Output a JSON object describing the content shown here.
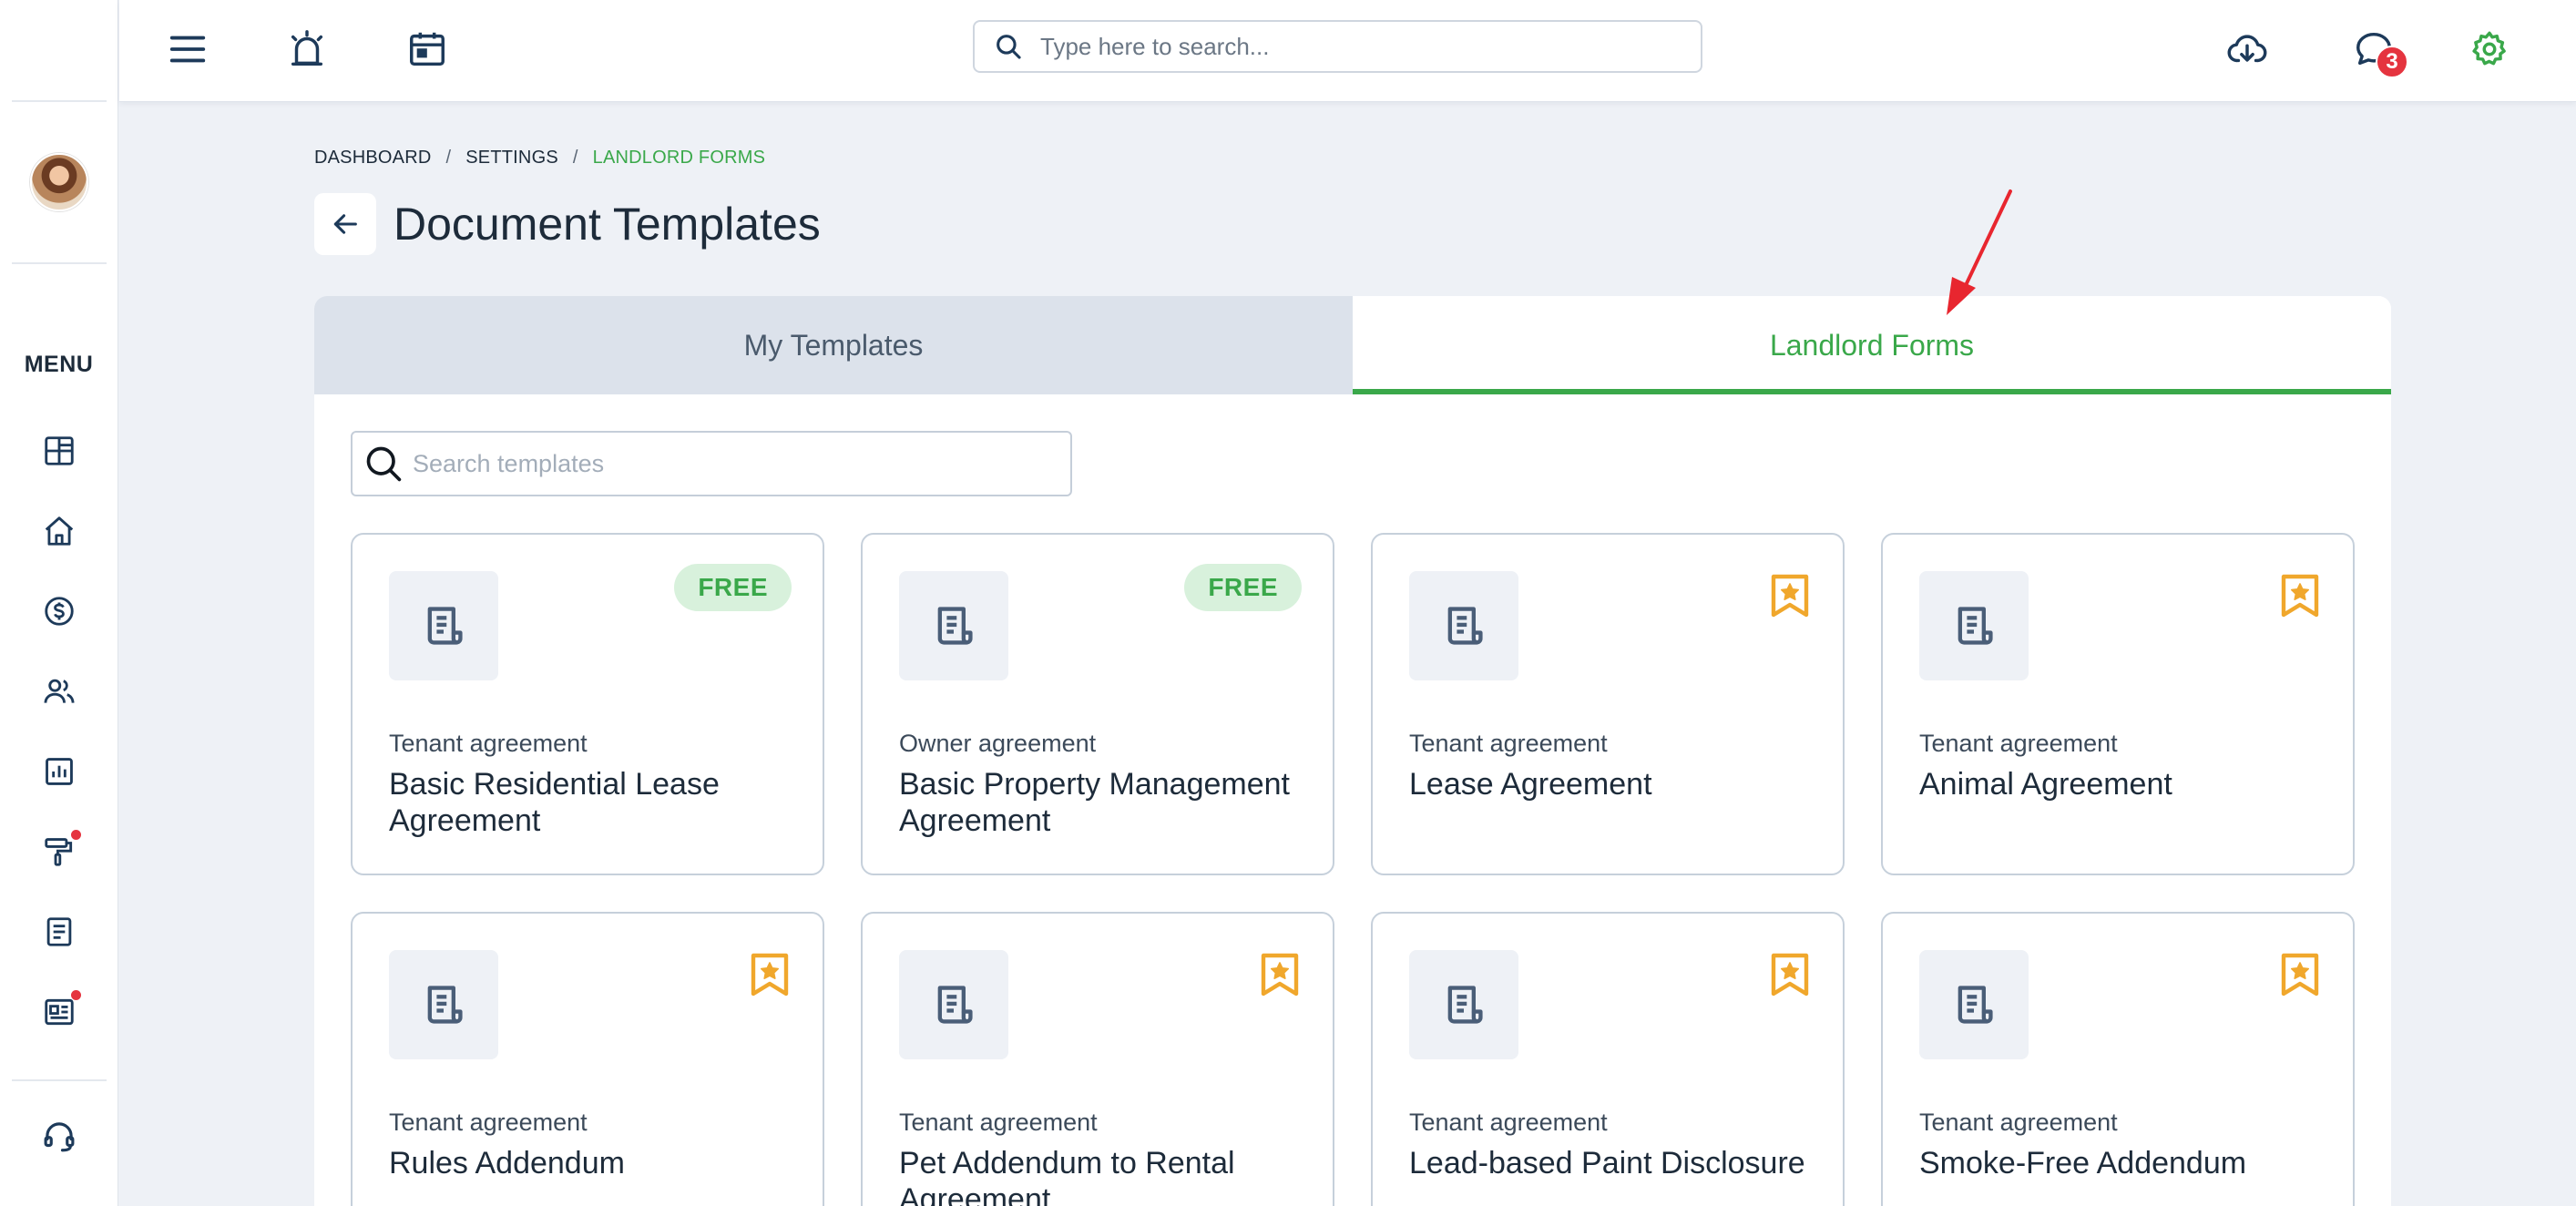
{
  "sidebar": {
    "menu_label": "MENU",
    "items": [
      {
        "name": "dashboard-icon",
        "dot": false
      },
      {
        "name": "home-icon",
        "dot": false
      },
      {
        "name": "dollar-icon",
        "dot": false
      },
      {
        "name": "users-icon",
        "dot": false
      },
      {
        "name": "reports-icon",
        "dot": false
      },
      {
        "name": "paint-roller-icon",
        "dot": true
      },
      {
        "name": "document-icon",
        "dot": false
      },
      {
        "name": "newspaper-icon",
        "dot": true
      }
    ],
    "support_icon": "headset-icon",
    "notification_dot_color": "#e5343f"
  },
  "topbar": {
    "search_placeholder": "Type here to search...",
    "chat_badge_count": "3",
    "icons": [
      "menu-icon",
      "alarm-icon",
      "calendar-icon",
      "download-cloud-icon",
      "chat-icon",
      "gear-icon"
    ]
  },
  "breadcrumb": {
    "items": [
      "DASHBOARD",
      "SETTINGS",
      "LANDLORD FORMS"
    ],
    "separator": "/"
  },
  "page": {
    "title": "Document Templates"
  },
  "tabs": [
    {
      "label": "My Templates",
      "active": false
    },
    {
      "label": "Landlord Forms",
      "active": true
    }
  ],
  "template_search": {
    "placeholder": "Search templates"
  },
  "templates": [
    {
      "category": "Tenant agreement",
      "title": "Basic Residential Lease Agreement",
      "badge": "FREE"
    },
    {
      "category": "Owner agreement",
      "title": "Basic Property Management Agreement",
      "badge": "FREE"
    },
    {
      "category": "Tenant agreement",
      "title": "Lease Agreement",
      "badge": ""
    },
    {
      "category": "Tenant agreement",
      "title": "Animal Agreement",
      "badge": ""
    },
    {
      "category": "Tenant agreement",
      "title": "Rules Addendum",
      "badge": ""
    },
    {
      "category": "Tenant agreement",
      "title": "Pet Addendum to Rental Agreement",
      "badge": ""
    },
    {
      "category": "Tenant agreement",
      "title": "Lead-based Paint Disclosure",
      "badge": ""
    },
    {
      "category": "Tenant agreement",
      "title": "Smoke-Free Addendum",
      "badge": ""
    }
  ],
  "colors": {
    "accent_green": "#3aa84a",
    "bookmark_orange": "#f0a72c",
    "badge_red": "#e5343f",
    "icon_slate": "#4a5e78"
  }
}
